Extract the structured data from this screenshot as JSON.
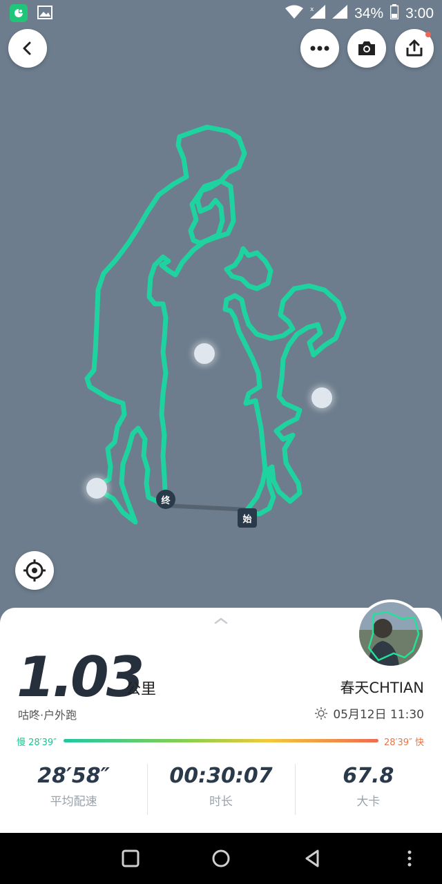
{
  "status_bar": {
    "battery": "34%",
    "time": "3:00",
    "icons": [
      "app-notification-icon",
      "image-icon",
      "wifi-icon",
      "signal-icon",
      "signal-icon",
      "battery-icon"
    ]
  },
  "map": {
    "start_label": "始",
    "end_label": "终",
    "route_color": "#1ed3a0",
    "background_color": "#6d7d8d"
  },
  "summary": {
    "distance": "1.03",
    "distance_unit": "公里",
    "user_name": "春天CHTIAN",
    "sport_type": "咕咚·户外跑",
    "date_time": "05月12日 11:30"
  },
  "pace_bar": {
    "slow_label": "慢 28′39″",
    "fast_label": "28′39″ 快"
  },
  "stats": [
    {
      "value": "28′58″",
      "label": "平均配速"
    },
    {
      "value": "00:30:07",
      "label": "时长"
    },
    {
      "value": "67.8",
      "label": "大卡"
    }
  ],
  "colors": {
    "accent": "#1fc392",
    "fast": "#e8764a",
    "text_dark": "#26303c"
  }
}
